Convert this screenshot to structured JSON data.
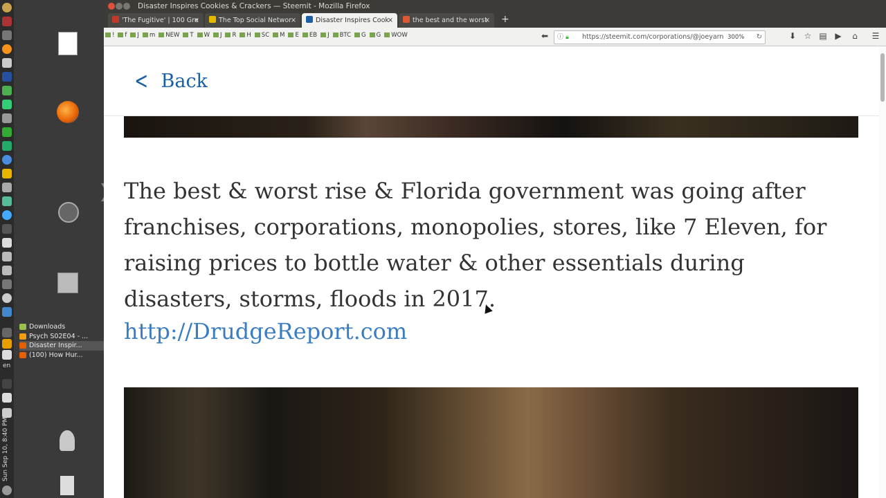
{
  "window": {
    "title": "Disaster Inspires Cookies & Crackers — Steemit - Mozilla Firefox"
  },
  "tabs": [
    {
      "label": "'The Fugitive' | 100 Gre",
      "icon": "r-icon",
      "color": "#c0392b"
    },
    {
      "label": "The Top Social Networ",
      "icon": "l-icon",
      "color": "#e6b800"
    },
    {
      "label": "Disaster Inspires Cook",
      "icon": "steemit-icon",
      "color": "#1a5ea8",
      "active": true
    },
    {
      "label": "the best and the worst",
      "icon": "duckduckgo-icon",
      "color": "#de5833"
    }
  ],
  "bookmarks": [
    "!",
    "f",
    "J",
    "m",
    "NEW",
    "T",
    "W",
    "J",
    "R",
    "H",
    "SC",
    "M",
    "E",
    "EB",
    "J",
    "BTC",
    "G",
    "G",
    "WOW"
  ],
  "urlbar": {
    "url": "https://steemit.com/corporations/@joeyarnol",
    "zoom": "300%"
  },
  "desktop_files": [
    {
      "name": "Downloads",
      "color": "#9ac04e"
    },
    {
      "name": "Psych S02E04 - ...",
      "color": "#f39c12"
    },
    {
      "name": "Disaster Inspir...",
      "color": "#e66000",
      "selected": true
    },
    {
      "name": "(100) How Hur...",
      "color": "#e66000"
    }
  ],
  "panel": {
    "clock": "Sun Sep 10, 8:40 PM",
    "lang": "en"
  },
  "page": {
    "back_label": "Back",
    "paragraph": "The best & worst rise & Florida government was going after franchises, corporations, monopolies, stores, like 7 Eleven, for raising prices to bottle water & other essentials during disasters, storms, floods in 2017.",
    "link": "http://DrudgeReport.com",
    "link_color": "#3b7dc1"
  }
}
